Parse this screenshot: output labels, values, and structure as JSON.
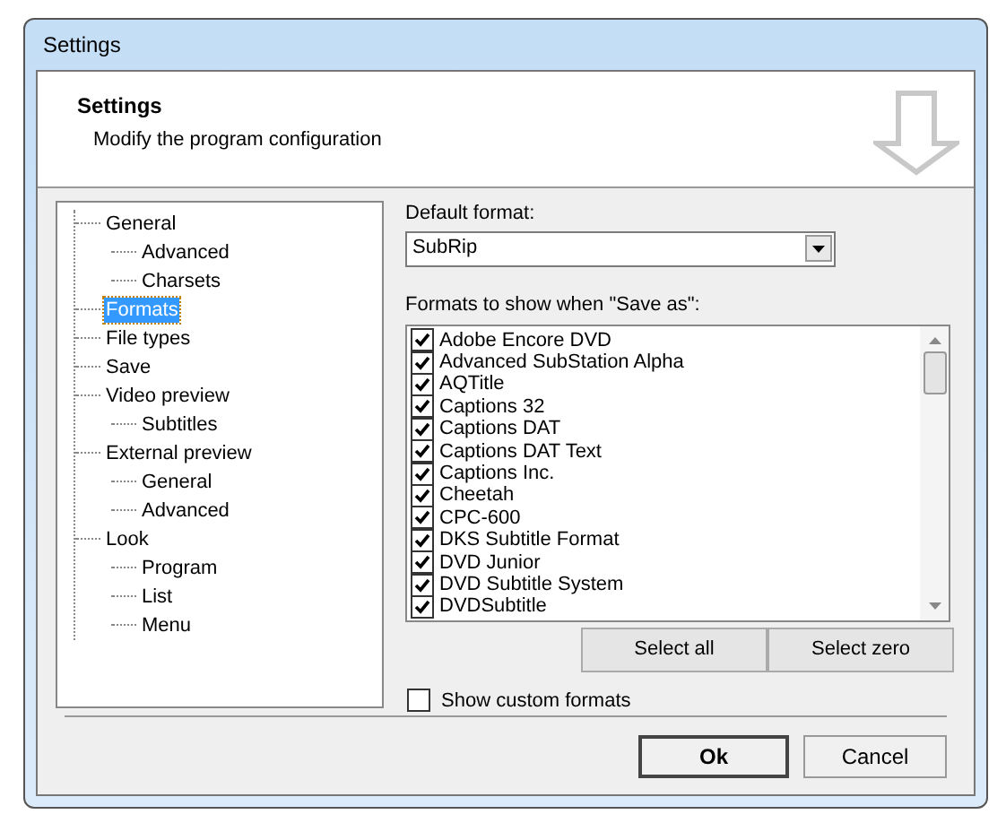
{
  "window": {
    "title": "Settings"
  },
  "header": {
    "title": "Settings",
    "subtitle": "Modify the program configuration"
  },
  "tree": [
    {
      "label": "General",
      "selected": false,
      "children": [
        {
          "label": "Advanced",
          "selected": false
        },
        {
          "label": "Charsets",
          "selected": false
        }
      ]
    },
    {
      "label": "Formats",
      "selected": true
    },
    {
      "label": "File types",
      "selected": false
    },
    {
      "label": "Save",
      "selected": false
    },
    {
      "label": "Video preview",
      "selected": false,
      "children": [
        {
          "label": "Subtitles",
          "selected": false
        }
      ]
    },
    {
      "label": "External preview",
      "selected": false,
      "children": [
        {
          "label": "General",
          "selected": false
        },
        {
          "label": "Advanced",
          "selected": false
        }
      ]
    },
    {
      "label": "Look",
      "selected": false,
      "children": [
        {
          "label": "Program",
          "selected": false
        },
        {
          "label": "List",
          "selected": false
        },
        {
          "label": "Menu",
          "selected": false
        }
      ]
    }
  ],
  "default_format": {
    "label": "Default format:",
    "value": "SubRip"
  },
  "formats": {
    "label": "Formats to show when \"Save as\":",
    "items": [
      {
        "label": "Adobe Encore DVD",
        "checked": true
      },
      {
        "label": "Advanced SubStation Alpha",
        "checked": true
      },
      {
        "label": "AQTitle",
        "checked": true
      },
      {
        "label": "Captions 32",
        "checked": true
      },
      {
        "label": "Captions DAT",
        "checked": true
      },
      {
        "label": "Captions DAT Text",
        "checked": true
      },
      {
        "label": "Captions Inc.",
        "checked": true
      },
      {
        "label": "Cheetah",
        "checked": true
      },
      {
        "label": "CPC-600",
        "checked": true
      },
      {
        "label": "DKS Subtitle Format",
        "checked": true
      },
      {
        "label": "DVD Junior",
        "checked": true
      },
      {
        "label": "DVD Subtitle System",
        "checked": true
      },
      {
        "label": "DVDSubtitle",
        "checked": true
      }
    ]
  },
  "select_buttons": [
    "Select all",
    "Select zero"
  ],
  "show_custom": {
    "label": "Show custom formats",
    "checked": false
  },
  "buttons": [
    {
      "label": "Ok",
      "default": true
    },
    {
      "label": "Cancel",
      "default": false
    }
  ]
}
